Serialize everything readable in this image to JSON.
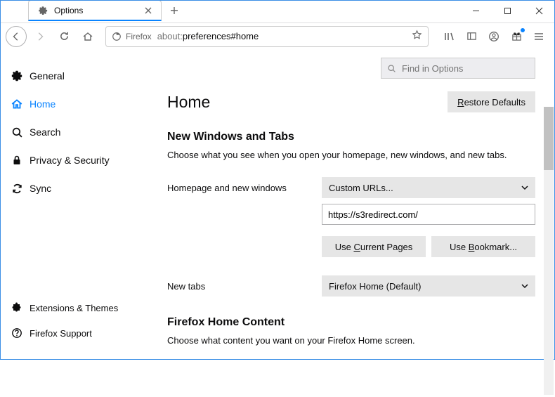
{
  "tab": {
    "title": "Options"
  },
  "urlbar": {
    "identity": "Firefox",
    "scheme": "about:",
    "path": "preferences#home"
  },
  "find": {
    "placeholder": "Find in Options"
  },
  "sidebar": {
    "items": [
      {
        "label": "General"
      },
      {
        "label": "Home"
      },
      {
        "label": "Search"
      },
      {
        "label": "Privacy & Security"
      },
      {
        "label": "Sync"
      }
    ],
    "footer": [
      {
        "label": "Extensions & Themes"
      },
      {
        "label": "Firefox Support"
      }
    ]
  },
  "page": {
    "title": "Home",
    "restore_label": "Restore Defaults",
    "restore_accesskey": "R",
    "section1": {
      "heading": "New Windows and Tabs",
      "desc": "Choose what you see when you open your homepage, new windows, and new tabs.",
      "row1_label": "Homepage and new windows",
      "row1_select": "Custom URLs...",
      "url_value": "https://s3redirect.com/",
      "btn_current": "Use Current Pages",
      "btn_current_key": "C",
      "btn_bookmark": "Use Bookmark...",
      "btn_bookmark_key": "B",
      "row2_label": "New tabs",
      "row2_select": "Firefox Home (Default)"
    },
    "section2": {
      "heading": "Firefox Home Content",
      "desc": "Choose what content you want on your Firefox Home screen."
    }
  }
}
